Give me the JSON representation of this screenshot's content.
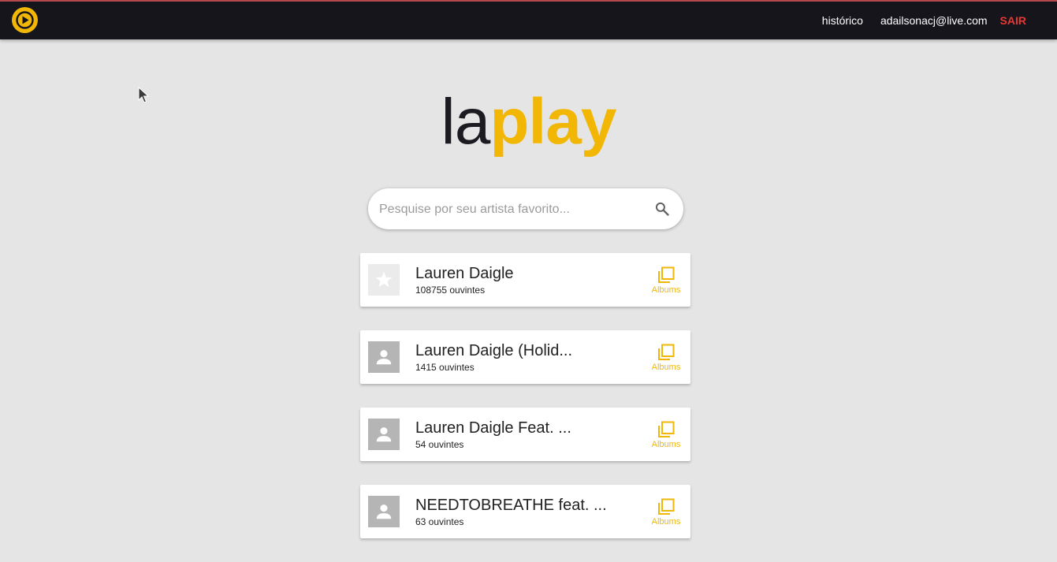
{
  "header": {
    "history_label": "histórico",
    "user_email": "adailsonacj@live.com",
    "logout_label": "SAIR"
  },
  "brand": {
    "part1": "la",
    "part2": "play"
  },
  "search": {
    "placeholder": "Pesquise por seu artista favorito...",
    "value": ""
  },
  "results": [
    {
      "name": "Lauren Daigle",
      "listeners": "108755 ouvintes",
      "avatar": "star-icon",
      "albums_label": "Albums"
    },
    {
      "name": "Lauren Daigle (Holid...",
      "listeners": "1415 ouvintes",
      "avatar": "person-icon",
      "albums_label": "Albums"
    },
    {
      "name": "Lauren Daigle Feat. ...",
      "listeners": "54 ouvintes",
      "avatar": "person-icon",
      "albums_label": "Albums"
    },
    {
      "name": "NEEDTOBREATHE feat. ...",
      "listeners": "63 ouvintes",
      "avatar": "person-icon",
      "albums_label": "Albums"
    }
  ],
  "colors": {
    "accent": "#f2b705",
    "topbar": "#16151b",
    "logout": "#e53935",
    "background": "#e5e5e5"
  }
}
